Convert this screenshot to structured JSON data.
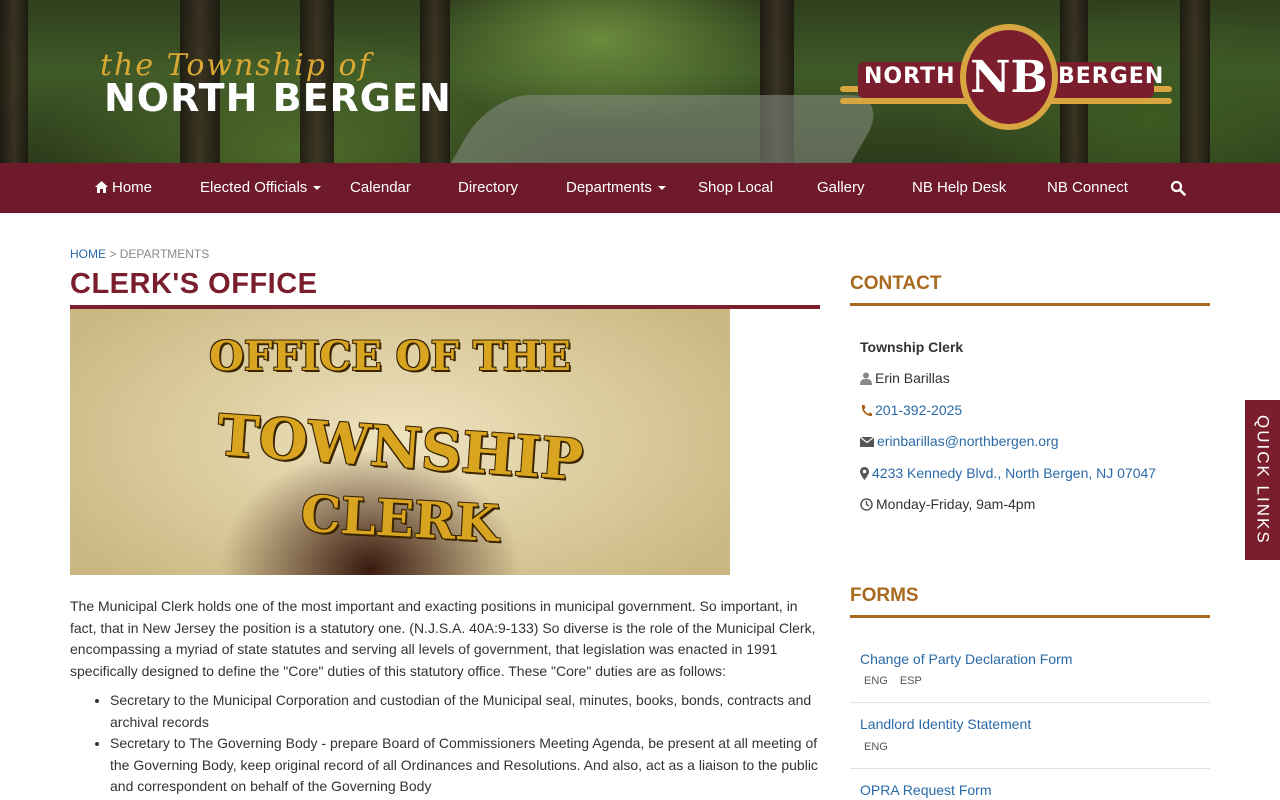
{
  "header": {
    "logo_script": "the Township of",
    "logo_main": "NORTH BERGEN",
    "badge_left": "NORTH",
    "badge_center": "NB",
    "badge_right": "BERGEN"
  },
  "nav": {
    "items": [
      {
        "label": "Home",
        "icon": "home-icon"
      },
      {
        "label": "Elected Officials",
        "dropdown": true
      },
      {
        "label": "Calendar"
      },
      {
        "label": "Directory"
      },
      {
        "label": "Departments",
        "dropdown": true
      },
      {
        "label": "Shop Local"
      },
      {
        "label": "Gallery"
      },
      {
        "label": "NB Help Desk"
      },
      {
        "label": "NB Connect"
      }
    ],
    "search_icon": "search-icon"
  },
  "breadcrumb": {
    "home": "HOME",
    "separator": ">",
    "current": "DEPARTMENTS"
  },
  "page": {
    "title": "CLERK'S OFFICE",
    "hero_text": [
      "OFFICE OF THE",
      "TOWNSHIP",
      "CLERK"
    ],
    "intro": " The Municipal Clerk holds one of the most important and exacting positions in municipal government. So important, in fact, that in New Jersey the position is a statutory one. (N.J.S.A. 40A:9-133) So diverse is the role of the Municipal Clerk, encompassing a myriad of state statutes and serving all levels of government, that legislation was enacted in 1991 specifically designed to define the \"Core\" duties of this statutory office. These \"Core\" duties are as follows:",
    "duties": [
      "Secretary to the Municipal Corporation and custodian of the Municipal seal, minutes, books, bonds, contracts and archival records",
      "Secretary to The Governing Body - prepare Board of Commissioners Meeting Agenda, be present at all meeting of the Governing Body, keep original record of all Ordinances and Resolutions. And also, act as a liaison to the public and correspondent on behalf of the Governing Body"
    ]
  },
  "contact": {
    "heading": "CONTACT",
    "title": "Township Clerk",
    "name": "Erin Barillas",
    "phone": "201-392-2025",
    "email": "erinbarillas@northbergen.org",
    "address": "4233 Kennedy Blvd., North Bergen, NJ 07047",
    "hours": "Monday-Friday, 9am-4pm"
  },
  "forms": {
    "heading": "FORMS",
    "items": [
      {
        "label": "Change of Party Declaration Form",
        "tags": [
          "ENG",
          "ESP"
        ]
      },
      {
        "label": "Landlord Identity Statement",
        "tags": [
          "ENG"
        ]
      },
      {
        "label": "OPRA Request Form",
        "tags": []
      }
    ]
  },
  "quick_links": {
    "label": "QUICK LINKS"
  },
  "colors": {
    "brand_maroon": "#6e1a2b",
    "accent_gold": "#a86a1e",
    "link_blue": "#2a6aa8"
  }
}
